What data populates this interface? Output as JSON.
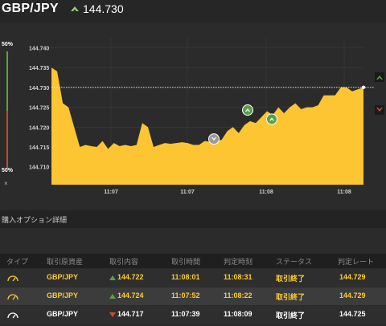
{
  "header": {
    "pair": "GBP/JPY",
    "price": "144.730",
    "accent": "#8fd468"
  },
  "sidebar": {
    "top_pct": "50%",
    "bottom_pct": "50%",
    "close": "×"
  },
  "chart_data": {
    "type": "area",
    "y_ticks": [
      "144.740",
      "144.735",
      "144.730",
      "144.725",
      "144.720",
      "144.715",
      "144.710"
    ],
    "x_ticks": [
      "11:07",
      "11:07",
      "11:08",
      "11:08"
    ],
    "ylim": [
      144.7055,
      144.7425
    ],
    "current_line": 144.73,
    "series": [
      {
        "values": [
          144.735,
          144.734,
          144.726,
          144.725,
          144.72,
          144.715,
          144.7155,
          144.7152,
          144.715,
          144.7165,
          144.7145,
          144.716,
          144.7152,
          144.7155,
          144.7152,
          144.7155,
          144.721,
          144.72,
          144.715,
          144.7155,
          144.716,
          144.7158,
          144.716,
          144.7162,
          144.716,
          144.7155,
          144.7155,
          144.7165,
          144.7163,
          144.7165,
          144.7168,
          144.719,
          144.72,
          144.7185,
          144.7205,
          144.7215,
          144.721,
          144.7225,
          144.724,
          144.723,
          144.725,
          144.7235,
          144.725,
          144.726,
          144.7245,
          144.725,
          144.725,
          144.7255,
          144.728,
          144.728,
          144.728,
          144.73,
          144.73,
          144.729,
          144.7295,
          144.73
        ]
      }
    ],
    "markers": [
      {
        "type": "up",
        "value": 144.7243
      },
      {
        "type": "down",
        "value": 144.717
      },
      {
        "type": "up",
        "value": 144.722
      }
    ],
    "colors": {
      "fill": "#fdc531",
      "up": "#58a046",
      "down": "#9a9a9a"
    }
  },
  "section": {
    "title": "購入オプション詳細"
  },
  "table": {
    "headers": [
      "タイプ",
      "取引原資産",
      "取引内容",
      "取引時間",
      "判定時刻",
      "ステータス",
      "判定レート"
    ],
    "rows": [
      {
        "asset": "GBP/JPY",
        "direction": "up",
        "rate": "144.722",
        "time": "11:08:01",
        "judge": "11:08:31",
        "status": "取引終了",
        "final": "144.729"
      },
      {
        "asset": "GBP/JPY",
        "direction": "up",
        "rate": "144.724",
        "time": "11:07:52",
        "judge": "11:08:22",
        "status": "取引終了",
        "final": "144.729"
      },
      {
        "asset": "GBP/JPY",
        "direction": "down",
        "rate": "144.717",
        "time": "11:07:39",
        "judge": "11:08:09",
        "status": "取引終了",
        "final": "144.725"
      }
    ]
  }
}
